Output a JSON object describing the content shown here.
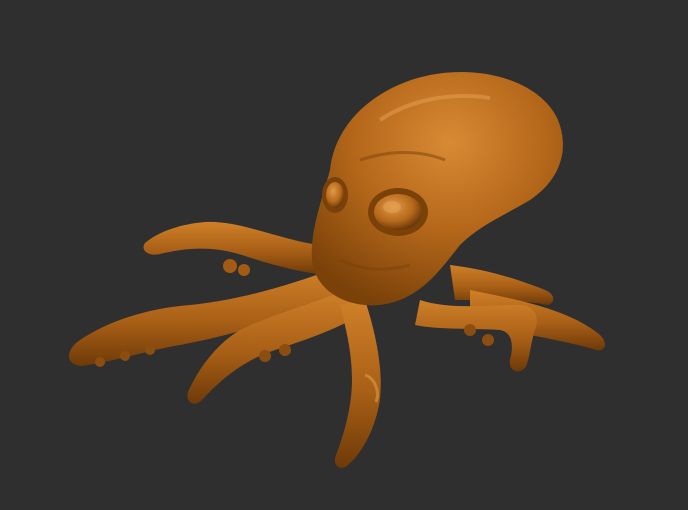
{
  "scene": {
    "background_color": "#2f2f2f",
    "model": {
      "subject": "octopus",
      "material_color": "#b5681a",
      "highlight_color": "#d98a34",
      "shadow_color": "#6e3a08"
    }
  }
}
